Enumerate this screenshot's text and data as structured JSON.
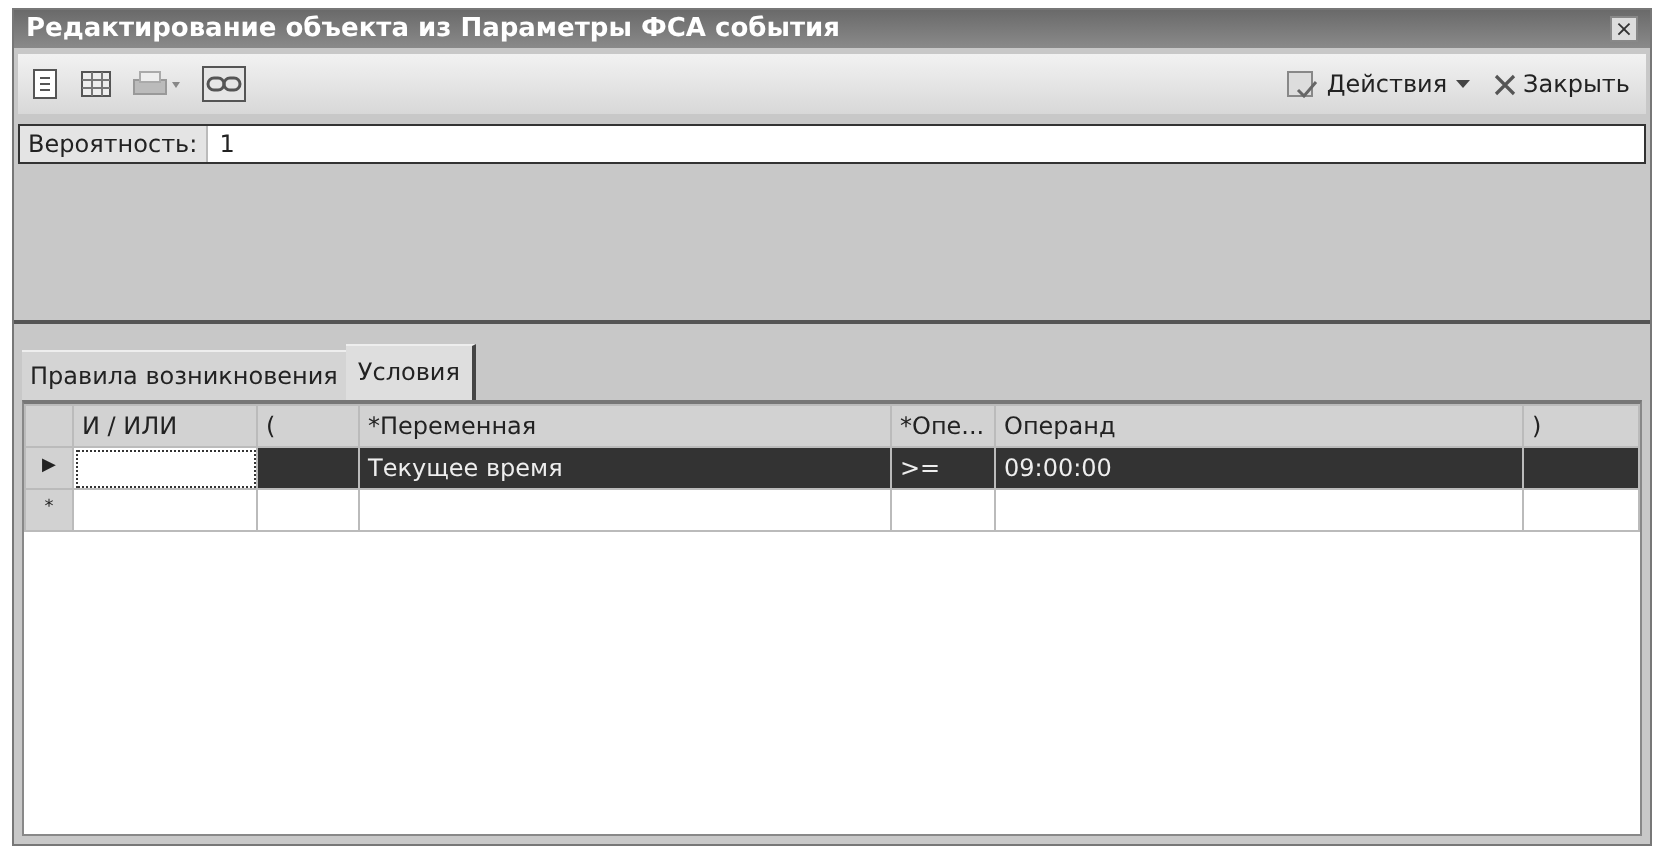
{
  "window": {
    "title": "Редактирование объекта из Параметры ФСА события",
    "close": "×"
  },
  "toolbar": {
    "actions": "Действия",
    "close": "Закрыть"
  },
  "field": {
    "label": "Вероятность:",
    "value": "1"
  },
  "tabs": [
    {
      "label": "Правила возникновения",
      "selected": false
    },
    {
      "label": "Условия",
      "selected": true
    }
  ],
  "table": {
    "columns": [
      "И / ИЛИ",
      "(",
      "*Переменная",
      "*Опе...",
      "Операнд",
      ")"
    ],
    "rows": [
      {
        "marker": "▶",
        "selected": true,
        "cells": [
          "",
          "",
          "Текущее время",
          ">=",
          "09:00:00",
          ""
        ]
      },
      {
        "marker": "*",
        "selected": false,
        "cells": [
          "",
          "",
          "",
          "",
          "",
          ""
        ]
      }
    ]
  }
}
